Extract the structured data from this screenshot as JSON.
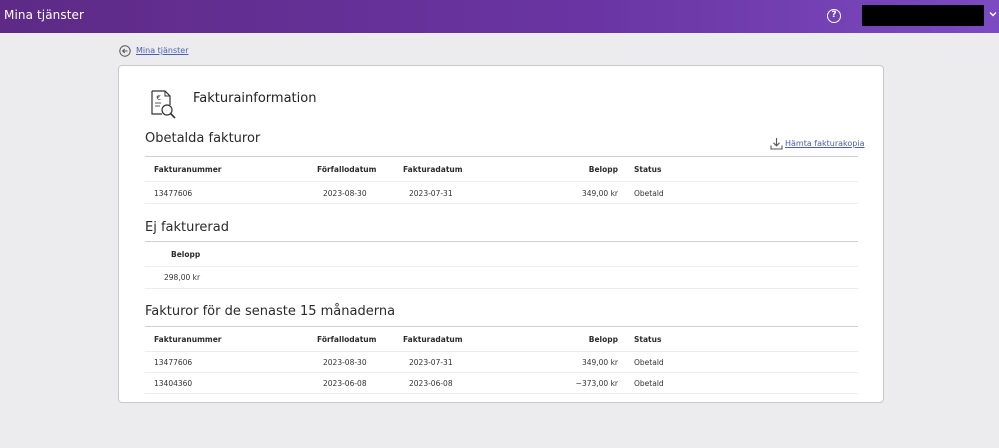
{
  "header": {
    "title": "Mina tjänster",
    "help_icon": "help-icon",
    "help_glyph": "?"
  },
  "breadcrumb": {
    "label": "Mina tjänster",
    "icon": "back-arrow-icon"
  },
  "page": {
    "title": "Fakturainformation",
    "icon": "invoice-search-icon"
  },
  "unpaid": {
    "title": "Obetalda fakturor",
    "download_label": "Hämta fakturakopia",
    "columns": [
      "Fakturanummer",
      "Förfallodatum",
      "Fakturadatum",
      "Belopp",
      "Status"
    ],
    "rows": [
      [
        "13477606",
        "2023-08-30",
        "2023-07-31",
        "349,00 kr",
        "Obetald"
      ]
    ]
  },
  "not_invoiced": {
    "title": "Ej fakturerad",
    "column": "Belopp",
    "amount": "298,00 kr"
  },
  "recent": {
    "title": "Fakturor för de senaste 15 månaderna",
    "columns": [
      "Fakturanummer",
      "Förfallodatum",
      "Fakturadatum",
      "Belopp",
      "Status"
    ],
    "rows": [
      [
        "13477606",
        "2023-08-30",
        "2023-07-31",
        "349,00 kr",
        "Obetald"
      ],
      [
        "13404360",
        "2023-06-08",
        "2023-06-08",
        "−373,00 kr",
        "Obetald"
      ]
    ]
  },
  "colors": {
    "header_start": "#5e2a86",
    "header_end": "#7c4bc2",
    "link": "#4b5fb0",
    "background": "#ececee"
  }
}
